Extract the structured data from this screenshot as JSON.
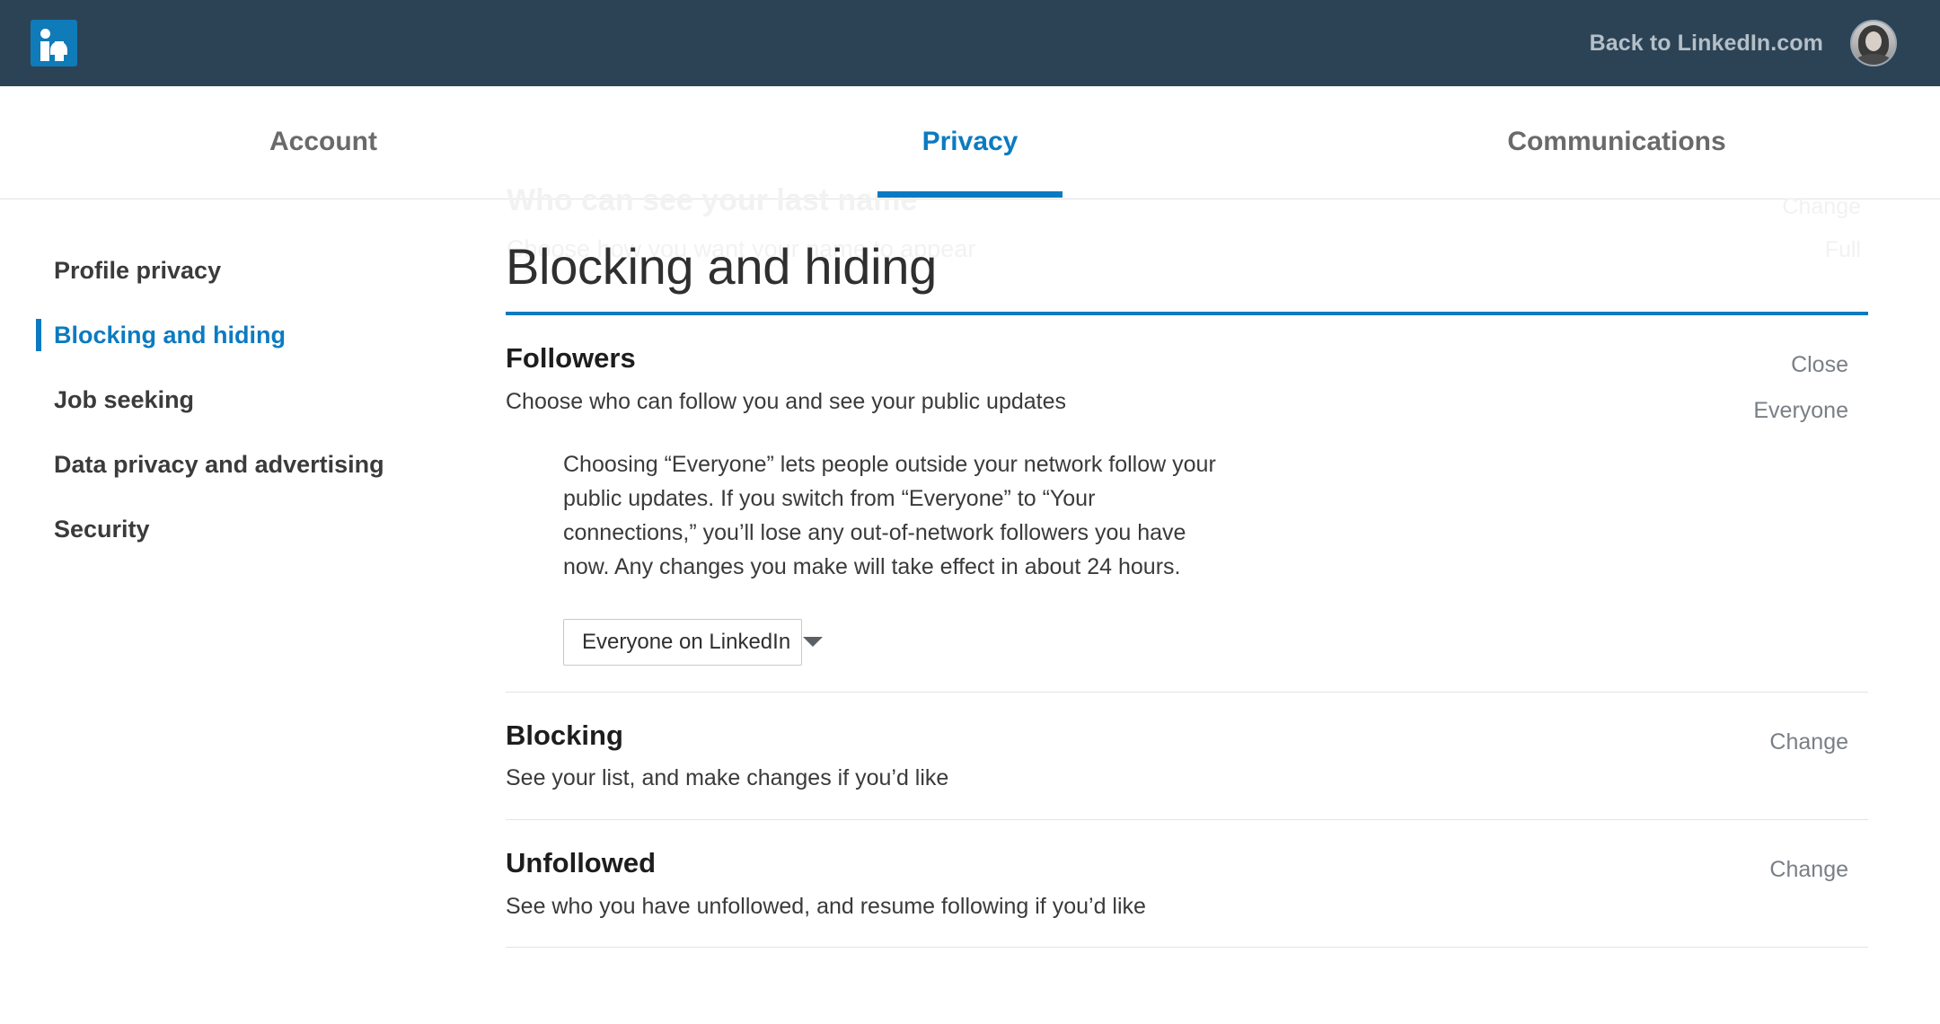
{
  "topbar": {
    "logo_text": "in",
    "back_link": "Back to LinkedIn.com",
    "avatar_label": "profile-photo"
  },
  "tabs": [
    {
      "label": "Account",
      "active": false
    },
    {
      "label": "Privacy",
      "active": true
    },
    {
      "label": "Communications",
      "active": false
    }
  ],
  "ghost": {
    "title": "Who can see your last name",
    "subtitle": "Choose how you want your name to appear",
    "action": "Change",
    "value": "Full"
  },
  "sidebar": {
    "items": [
      {
        "label": "Profile privacy",
        "active": false
      },
      {
        "label": "Blocking and hiding",
        "active": true
      },
      {
        "label": "Job seeking",
        "active": false
      },
      {
        "label": "Data privacy and advertising",
        "active": false
      },
      {
        "label": "Security",
        "active": false
      }
    ]
  },
  "main": {
    "page_title": "Blocking and hiding",
    "sections": [
      {
        "title": "Followers",
        "subtitle": "Choose who can follow you and see your public updates",
        "action": "Close",
        "value": "Everyone",
        "body": "Choosing “Everyone” lets people outside your network follow your public updates. If you switch from “Everyone” to “Your connections,” you’ll lose any out-of-network followers you have now. Any changes you make will take effect in about 24 hours.",
        "select_value": "Everyone on LinkedIn"
      },
      {
        "title": "Blocking",
        "subtitle": "See your list, and make changes if you’d like",
        "action": "Change"
      },
      {
        "title": "Unfollowed",
        "subtitle": "See who you have unfollowed, and resume following if you’d like",
        "action": "Change"
      }
    ]
  },
  "colors": {
    "brand_blue": "#0b7bc1",
    "topbar": "#2c4356",
    "logo_blue": "#0f7bb8",
    "muted_text": "#7a7f85"
  }
}
